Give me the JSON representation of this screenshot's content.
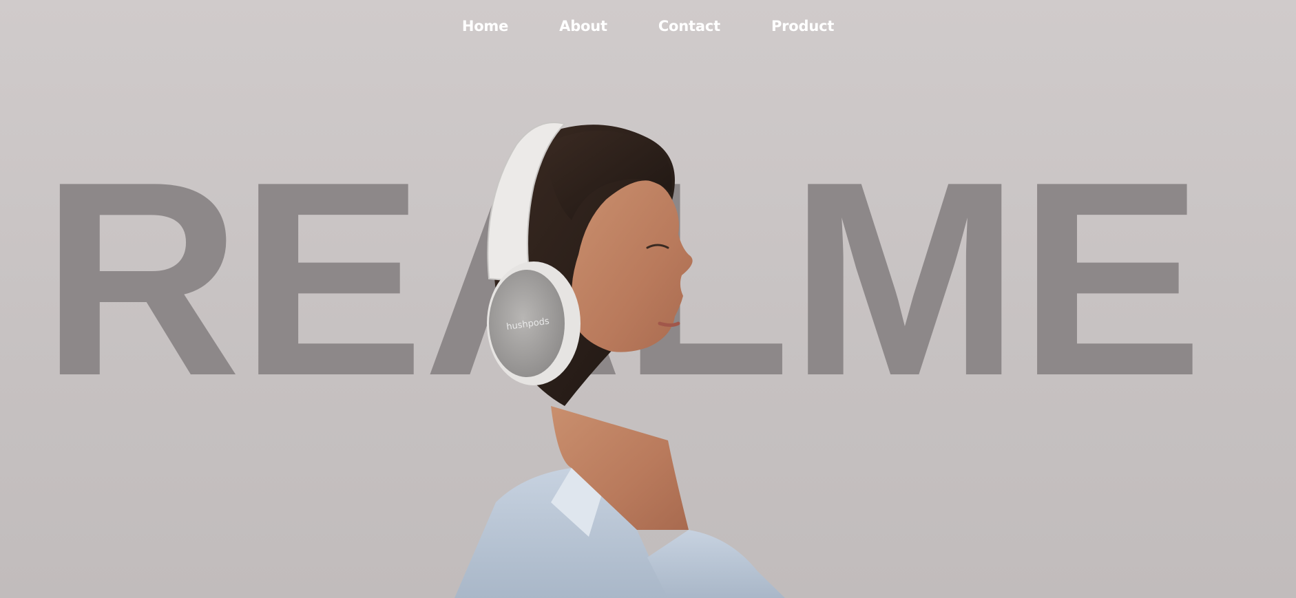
{
  "nav": {
    "items": [
      {
        "label": "Home"
      },
      {
        "label": "About"
      },
      {
        "label": "Contact"
      },
      {
        "label": "Product"
      }
    ]
  },
  "hero": {
    "word": "REALME",
    "image_alt": "Woman wearing white over-ear headphones looking upward",
    "headphone_brand": "hushpods"
  },
  "colors": {
    "background": "#cdc8c8",
    "hero_word": "#8d8889",
    "nav_text": "#ffffff"
  }
}
